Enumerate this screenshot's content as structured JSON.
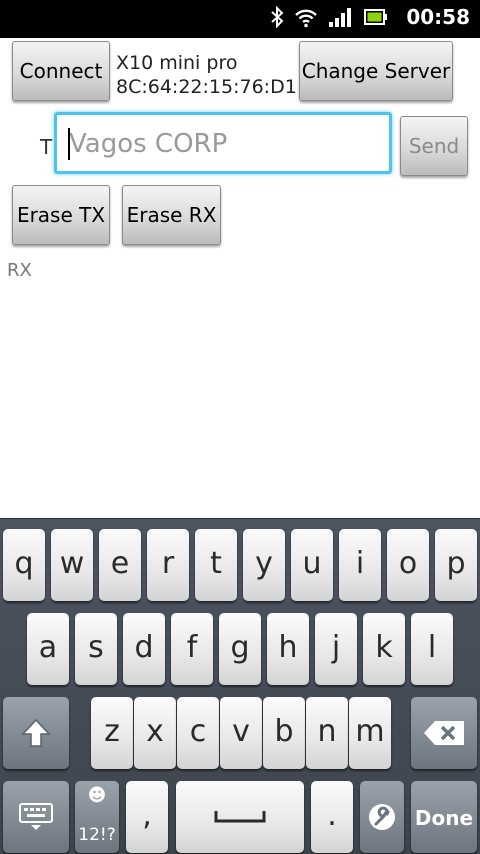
{
  "status_bar": {
    "time": "00:58",
    "icons": [
      "bluetooth-icon",
      "wifi-icon",
      "signal-icon",
      "battery-icon"
    ]
  },
  "app": {
    "connect_label": "Connect",
    "device_name": "X10 mini pro",
    "device_mac": "8C:64:22:15:76:D1",
    "change_server_label": "Change Server",
    "tx_label": "T",
    "tx_input": {
      "value": "",
      "placeholder": "Vagos CORP"
    },
    "send_label": "Send",
    "erase_tx_label": "Erase TX",
    "erase_rx_label": "Erase RX",
    "rx_label": "RX"
  },
  "keyboard": {
    "row1": [
      "q",
      "w",
      "e",
      "r",
      "t",
      "y",
      "u",
      "i",
      "o",
      "p"
    ],
    "row2": [
      "a",
      "s",
      "d",
      "f",
      "g",
      "h",
      "j",
      "k",
      "l"
    ],
    "row3": [
      "z",
      "x",
      "c",
      "v",
      "b",
      "n",
      "m"
    ],
    "symbols_label": "12!?",
    "comma": ",",
    "period": ".",
    "done_label": "Done",
    "colors": {
      "panel": "#3d444d",
      "key": "#f0f0f0",
      "dark_key": "#7f8790",
      "focus": "#4fc4ea"
    }
  }
}
